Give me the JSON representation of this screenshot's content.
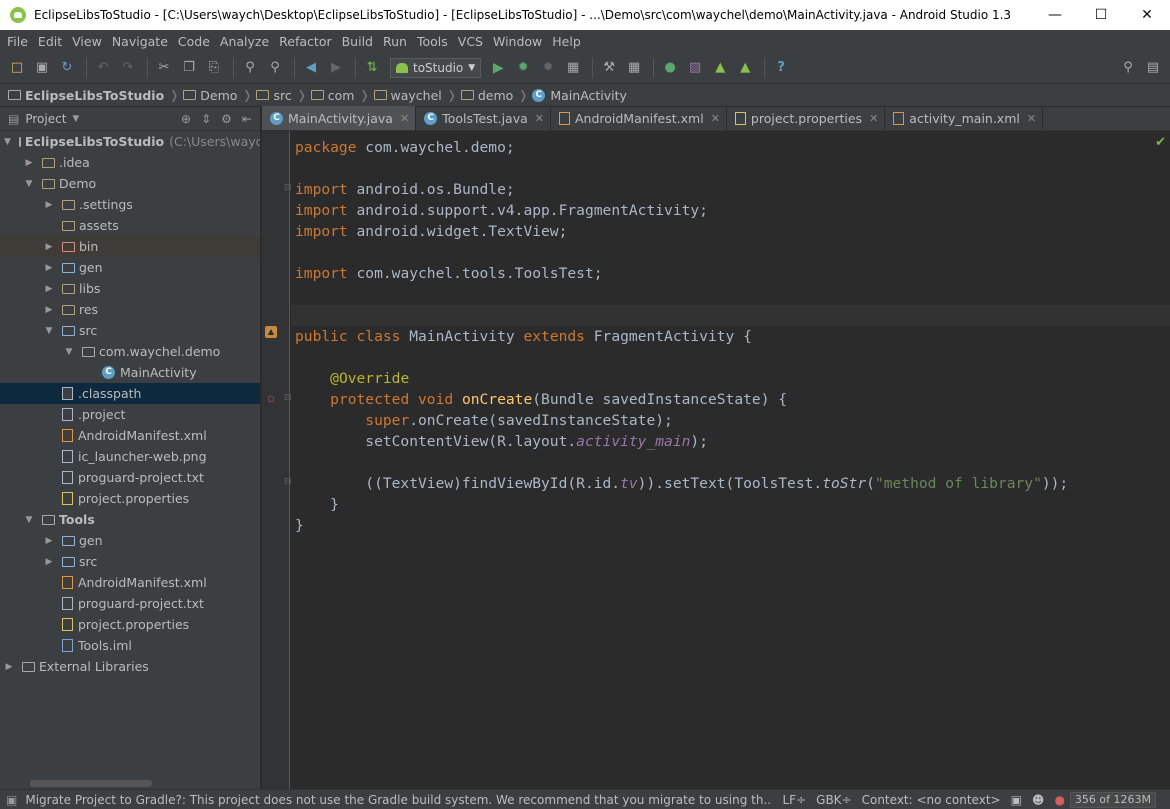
{
  "window": {
    "title": "EclipseLibsToStudio - [C:\\Users\\waych\\Desktop\\EclipseLibsToStudio] - [EclipseLibsToStudio] - ...\\Demo\\src\\com\\waychel\\demo\\MainActivity.java - Android Studio 1.3"
  },
  "menu": [
    "File",
    "Edit",
    "View",
    "Navigate",
    "Code",
    "Analyze",
    "Refactor",
    "Build",
    "Run",
    "Tools",
    "VCS",
    "Window",
    "Help"
  ],
  "toolbar": {
    "run_config": "toStudio"
  },
  "breadcrumbs": [
    "EclipseLibsToStudio",
    "Demo",
    "src",
    "com",
    "waychel",
    "demo",
    "MainActivity"
  ],
  "sidebar": {
    "title": "Project",
    "tree": [
      {
        "label": "EclipseLibsToStudio",
        "suffix": "(C:\\Users\\waych",
        "depth": 0,
        "arrow": "open",
        "icon": "module",
        "bold": true
      },
      {
        "label": ".idea",
        "depth": 1,
        "arrow": "closed",
        "icon": "folder"
      },
      {
        "label": "Demo",
        "depth": 1,
        "arrow": "open",
        "icon": "folder"
      },
      {
        "label": ".settings",
        "depth": 2,
        "arrow": "closed",
        "icon": "folder"
      },
      {
        "label": "assets",
        "depth": 2,
        "arrow": "none",
        "icon": "folder"
      },
      {
        "label": "bin",
        "depth": 2,
        "arrow": "closed",
        "icon": "folder-red",
        "hover": true
      },
      {
        "label": "gen",
        "depth": 2,
        "arrow": "closed",
        "icon": "folder-blue"
      },
      {
        "label": "libs",
        "depth": 2,
        "arrow": "closed",
        "icon": "folder"
      },
      {
        "label": "res",
        "depth": 2,
        "arrow": "closed",
        "icon": "folder"
      },
      {
        "label": "src",
        "depth": 2,
        "arrow": "open",
        "icon": "folder-blue"
      },
      {
        "label": "com.waychel.demo",
        "depth": 3,
        "arrow": "open",
        "icon": "package"
      },
      {
        "label": "MainActivity",
        "depth": 4,
        "arrow": "none",
        "icon": "class"
      },
      {
        "label": ".classpath",
        "depth": 2,
        "arrow": "none",
        "icon": "file",
        "selected": true
      },
      {
        "label": ".project",
        "depth": 2,
        "arrow": "none",
        "icon": "file"
      },
      {
        "label": "AndroidManifest.xml",
        "depth": 2,
        "arrow": "none",
        "icon": "xml"
      },
      {
        "label": "ic_launcher-web.png",
        "depth": 2,
        "arrow": "none",
        "icon": "file"
      },
      {
        "label": "proguard-project.txt",
        "depth": 2,
        "arrow": "none",
        "icon": "file"
      },
      {
        "label": "project.properties",
        "depth": 2,
        "arrow": "none",
        "icon": "prop"
      },
      {
        "label": "Tools",
        "depth": 1,
        "arrow": "open",
        "icon": "module",
        "bold": true
      },
      {
        "label": "gen",
        "depth": 2,
        "arrow": "closed",
        "icon": "folder-blue"
      },
      {
        "label": "src",
        "depth": 2,
        "arrow": "closed",
        "icon": "folder-blue"
      },
      {
        "label": "AndroidManifest.xml",
        "depth": 2,
        "arrow": "none",
        "icon": "xml"
      },
      {
        "label": "proguard-project.txt",
        "depth": 2,
        "arrow": "none",
        "icon": "file"
      },
      {
        "label": "project.properties",
        "depth": 2,
        "arrow": "none",
        "icon": "prop"
      },
      {
        "label": "Tools.iml",
        "depth": 2,
        "arrow": "none",
        "icon": "iml"
      },
      {
        "label": "External Libraries",
        "depth": 0,
        "arrow": "closed",
        "icon": "libs"
      }
    ]
  },
  "tabs": [
    {
      "label": "MainActivity.java",
      "icon": "class",
      "active": true
    },
    {
      "label": "ToolsTest.java",
      "icon": "class"
    },
    {
      "label": "AndroidManifest.xml",
      "icon": "xml"
    },
    {
      "label": "project.properties",
      "icon": "prop"
    },
    {
      "label": "activity_main.xml",
      "icon": "xml"
    }
  ],
  "code": [
    [
      [
        "kw",
        "package "
      ],
      [
        "",
        "com.waychel.demo;"
      ]
    ],
    [],
    [
      [
        "kw",
        "import "
      ],
      [
        "",
        "android.os.Bundle;"
      ]
    ],
    [
      [
        "kw",
        "import "
      ],
      [
        "",
        "android.support.v4.app.FragmentActivity;"
      ]
    ],
    [
      [
        "kw",
        "import "
      ],
      [
        "",
        "android.widget.TextView;"
      ]
    ],
    [],
    [
      [
        "kw",
        "import "
      ],
      [
        "",
        "com.waychel.tools.ToolsTest;"
      ]
    ],
    [],
    [],
    [
      [
        "kw",
        "public class "
      ],
      [
        "",
        "MainActivity "
      ],
      [
        "kw",
        "extends "
      ],
      [
        "",
        "FragmentActivity {"
      ]
    ],
    [],
    [
      [
        "",
        "    "
      ],
      [
        "an",
        "@Override"
      ]
    ],
    [
      [
        "",
        "    "
      ],
      [
        "kw",
        "protected void "
      ],
      [
        "fn",
        "onCreate"
      ],
      [
        "",
        "(Bundle savedInstanceState) {"
      ]
    ],
    [
      [
        "",
        "        "
      ],
      [
        "kw",
        "super"
      ],
      [
        "",
        ".onCreate(savedInstanceState);"
      ]
    ],
    [
      [
        "",
        "        setContentView(R.layout."
      ],
      [
        "pu",
        "activity_main"
      ],
      [
        "",
        ");"
      ]
    ],
    [],
    [
      [
        "",
        "        ((TextView)findViewById(R.id."
      ],
      [
        "pu",
        "tv"
      ],
      [
        "",
        ")).setText(ToolsTest."
      ],
      [
        "it",
        "toStr"
      ],
      [
        "",
        "("
      ],
      [
        "st",
        "\"method of library\""
      ],
      [
        "",
        "));"
      ]
    ],
    [
      [
        "",
        "    }"
      ]
    ],
    [
      [
        "",
        "}"
      ]
    ]
  ],
  "status": {
    "message": "Migrate Project to Gradle?: This project does not use the Gradle build system. We recommend that you migrate to using th..",
    "line_sep": "LF÷",
    "encoding": "GBK÷",
    "context": "Context: <no context>",
    "memory": "356 of 1263M"
  }
}
